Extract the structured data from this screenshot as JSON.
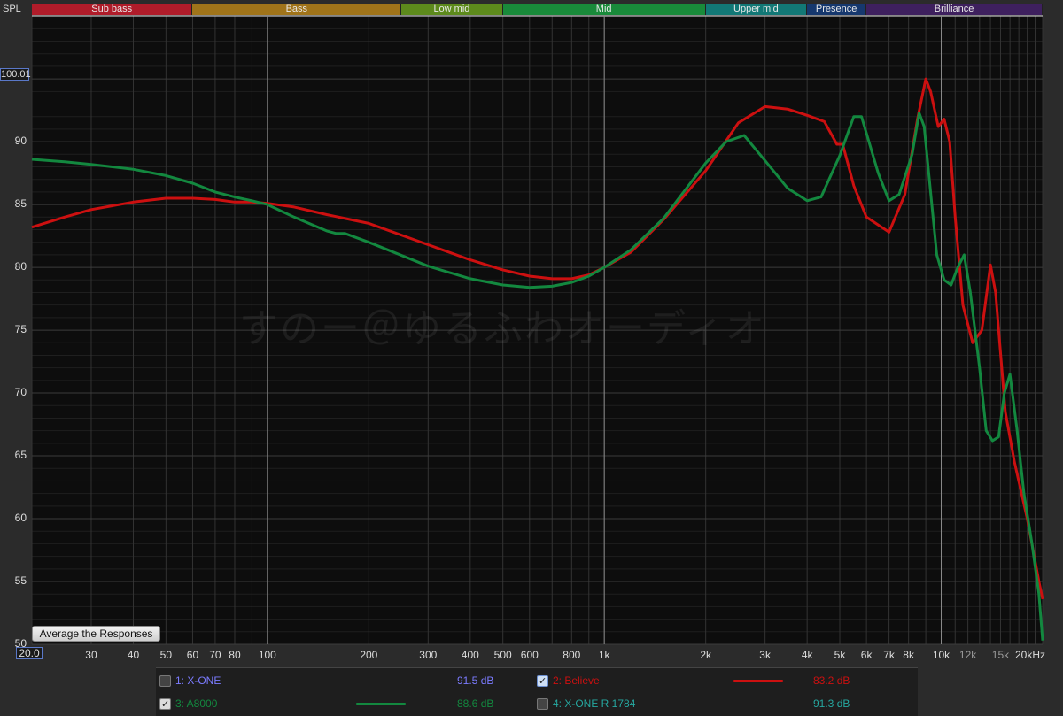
{
  "axis": {
    "y_label": "SPL",
    "y_top_box": "100.01",
    "x_min_box": "20.0"
  },
  "bands": [
    {
      "label": "Sub bass",
      "color": "#b01c2a"
    },
    {
      "label": "Bass",
      "color": "#a0741a"
    },
    {
      "label": "Low mid",
      "color": "#5d8a1c"
    },
    {
      "label": "Mid",
      "color": "#198a3a"
    },
    {
      "label": "Upper mid",
      "color": "#127876"
    },
    {
      "label": "Presence",
      "color": "#16386e"
    },
    {
      "label": "Brilliance",
      "color": "#3e205e"
    }
  ],
  "button": {
    "average_label": "Average the Responses"
  },
  "watermark": "すのー＠ゆるふわオーディオ",
  "legend": [
    {
      "name": "1: X-ONE",
      "db": "91.5 dB",
      "checked": false,
      "color": "#7b7bff"
    },
    {
      "name": "2: Believe",
      "db": "83.2 dB",
      "checked": true,
      "color": "#cc1010"
    },
    {
      "name": "3: A8000",
      "db": "88.6 dB",
      "checked": true,
      "color": "#13883f"
    },
    {
      "name": "4: X-ONE R 1784",
      "db": "91.3 dB",
      "checked": false,
      "color": "#26a8a0"
    }
  ],
  "chart_data": {
    "type": "line",
    "xlabel": "",
    "ylabel": "SPL",
    "xscale": "log",
    "xlim": [
      20,
      20000
    ],
    "ylim": [
      50,
      100.01
    ],
    "grid": true,
    "y_ticks": [
      "95",
      "90",
      "85",
      "80",
      "75",
      "70",
      "65",
      "60",
      "55",
      "50"
    ],
    "x_ticks": [
      {
        "label": "30",
        "v": 30,
        "grey": false
      },
      {
        "label": "40",
        "v": 40,
        "grey": false
      },
      {
        "label": "50",
        "v": 50,
        "grey": false
      },
      {
        "label": "60",
        "v": 60,
        "grey": false
      },
      {
        "label": "70",
        "v": 70,
        "grey": false
      },
      {
        "label": "80",
        "v": 80,
        "grey": false
      },
      {
        "label": "100",
        "v": 100,
        "grey": false
      },
      {
        "label": "200",
        "v": 200,
        "grey": false
      },
      {
        "label": "300",
        "v": 300,
        "grey": false
      },
      {
        "label": "400",
        "v": 400,
        "grey": false
      },
      {
        "label": "500",
        "v": 500,
        "grey": false
      },
      {
        "label": "600",
        "v": 600,
        "grey": false
      },
      {
        "label": "800",
        "v": 800,
        "grey": false
      },
      {
        "label": "1k",
        "v": 1000,
        "grey": false
      },
      {
        "label": "2k",
        "v": 2000,
        "grey": false
      },
      {
        "label": "3k",
        "v": 3000,
        "grey": false
      },
      {
        "label": "4k",
        "v": 4000,
        "grey": false
      },
      {
        "label": "5k",
        "v": 5000,
        "grey": false
      },
      {
        "label": "6k",
        "v": 6000,
        "grey": false
      },
      {
        "label": "7k",
        "v": 7000,
        "grey": false
      },
      {
        "label": "8k",
        "v": 8000,
        "grey": false
      },
      {
        "label": "10k",
        "v": 10000,
        "grey": false
      },
      {
        "label": "12k",
        "v": 12000,
        "grey": true
      },
      {
        "label": "15k",
        "v": 15000,
        "grey": true
      },
      {
        "label": "20kHz",
        "v": 20000,
        "grey": false
      }
    ],
    "series": [
      {
        "name": "2: Believe",
        "color": "#cc1010",
        "x": [
          20,
          25,
          30,
          40,
          50,
          60,
          70,
          80,
          90,
          100,
          120,
          150,
          200,
          300,
          400,
          500,
          600,
          700,
          800,
          900,
          1000,
          1200,
          1500,
          2000,
          2500,
          3000,
          3500,
          4000,
          4500,
          4900,
          5100,
          5500,
          6000,
          7000,
          7800,
          8500,
          9000,
          9300,
          9800,
          10200,
          10600,
          11000,
          11600,
          12400,
          13200,
          14000,
          14500,
          15500,
          16500,
          18000,
          19500,
          20000
        ],
        "y": [
          83.2,
          84.0,
          84.6,
          85.2,
          85.5,
          85.5,
          85.4,
          85.2,
          85.2,
          85.1,
          84.8,
          84.2,
          83.5,
          81.8,
          80.6,
          79.8,
          79.3,
          79.1,
          79.1,
          79.4,
          80.0,
          81.2,
          83.8,
          87.7,
          91.5,
          92.8,
          92.6,
          92.1,
          91.6,
          89.8,
          89.8,
          86.5,
          84.0,
          82.8,
          85.8,
          91.8,
          95.0,
          94.0,
          91.2,
          91.8,
          90.0,
          84.0,
          77.0,
          74.0,
          75.0,
          80.2,
          78.0,
          68.5,
          64.5,
          60.0,
          55.0,
          53.6
        ]
      },
      {
        "name": "3: A8000",
        "color": "#13883f",
        "x": [
          20,
          25,
          30,
          40,
          50,
          60,
          70,
          80,
          90,
          100,
          120,
          150,
          160,
          170,
          200,
          300,
          400,
          500,
          600,
          700,
          800,
          900,
          1000,
          1200,
          1500,
          2000,
          2300,
          2600,
          3000,
          3500,
          4000,
          4400,
          5000,
          5500,
          5800,
          6100,
          6500,
          7000,
          7500,
          8200,
          8600,
          8900,
          9300,
          9700,
          10200,
          10700,
          11200,
          11700,
          12200,
          13000,
          13600,
          14200,
          14800,
          15400,
          16000,
          16800,
          17600,
          18600,
          19500,
          20000
        ],
        "y": [
          88.6,
          88.4,
          88.2,
          87.8,
          87.3,
          86.7,
          86.0,
          85.6,
          85.3,
          85.0,
          84.0,
          82.9,
          82.7,
          82.7,
          82.0,
          80.1,
          79.1,
          78.6,
          78.4,
          78.5,
          78.8,
          79.3,
          80.0,
          81.4,
          83.9,
          88.3,
          90.0,
          90.5,
          88.5,
          86.3,
          85.3,
          85.6,
          88.9,
          92.0,
          92.0,
          90.0,
          87.5,
          85.3,
          85.8,
          89.0,
          92.3,
          91.2,
          86.0,
          81.0,
          79.0,
          78.6,
          80.0,
          81.0,
          78.0,
          72.0,
          67.0,
          66.2,
          66.5,
          70.0,
          71.5,
          67.0,
          62.0,
          58.0,
          54.0,
          50.3
        ]
      }
    ]
  }
}
